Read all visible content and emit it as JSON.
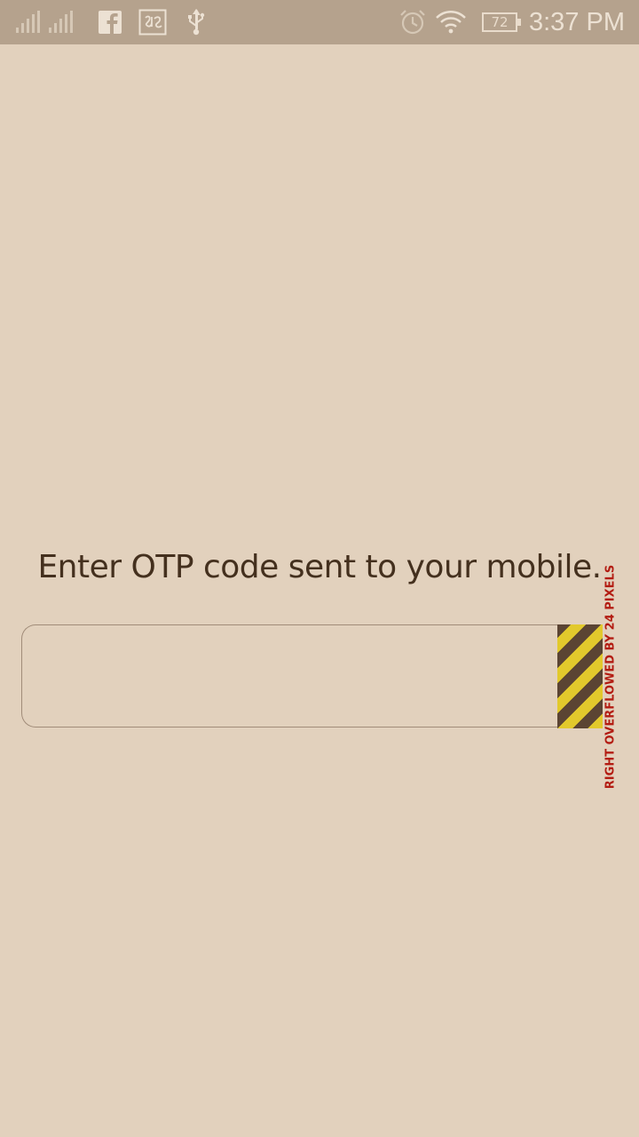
{
  "status_bar": {
    "battery_level": "72",
    "time": "3:37 PM",
    "icons": [
      "cell-signal-1-icon",
      "cell-signal-2-icon",
      "facebook-icon",
      "keyboard-lang-icon",
      "usb-icon",
      "alarm-icon",
      "wifi-icon",
      "battery-icon"
    ]
  },
  "otp": {
    "prompt": "Enter OTP code sent to your mobile.",
    "value": "",
    "placeholder": ""
  },
  "debug_overlay": {
    "label": "RIGHT OVERFLOWED BY 24 PIXELS"
  },
  "colors": {
    "background": "#e2d1bd",
    "status_bar": "#b5a28d",
    "prompt_text": "#44301e",
    "field_border": "#a18c79",
    "overflow_yellow": "#e2c92c",
    "overflow_dark": "#5b4433",
    "overflow_label": "#b31c12"
  }
}
